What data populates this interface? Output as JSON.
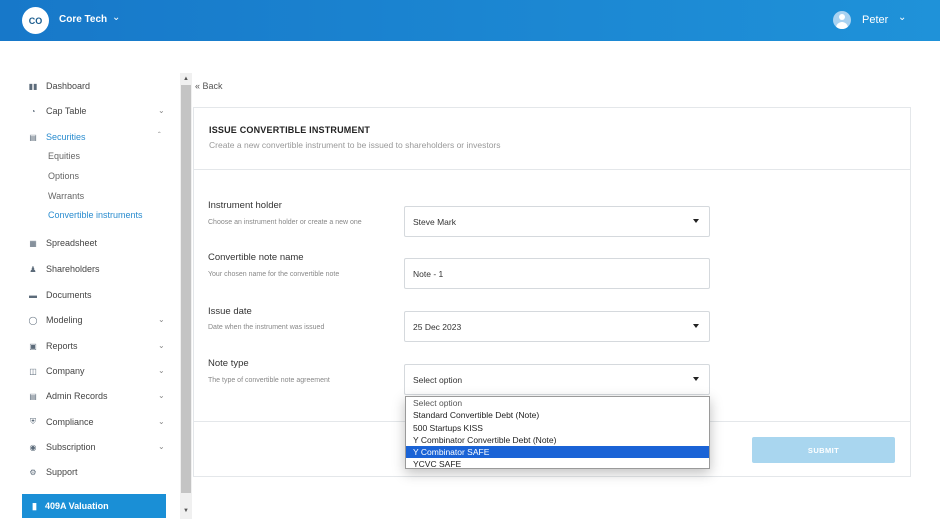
{
  "header": {
    "company_initials": "CO",
    "company_name": "Core Tech",
    "user_name": "Peter"
  },
  "sidebar": {
    "items": [
      {
        "label": "Dashboard",
        "icon": "dashboard-icon"
      },
      {
        "label": "Cap Table",
        "icon": "pie-chart-icon",
        "expandable": true
      },
      {
        "label": "Securities",
        "icon": "clipboard-icon",
        "expandable": true,
        "expanded": true,
        "active": true
      },
      {
        "label": "Spreadsheet",
        "icon": "spreadsheet-icon"
      },
      {
        "label": "Shareholders",
        "icon": "person-icon"
      },
      {
        "label": "Documents",
        "icon": "folder-icon"
      },
      {
        "label": "Modeling",
        "icon": "lightbulb-icon",
        "expandable": true
      },
      {
        "label": "Reports",
        "icon": "report-icon",
        "expandable": true
      },
      {
        "label": "Company",
        "icon": "building-icon",
        "expandable": true
      },
      {
        "label": "Admin Records",
        "icon": "records-icon",
        "expandable": true
      },
      {
        "label": "Compliance",
        "icon": "shield-icon",
        "expandable": true
      },
      {
        "label": "Subscription",
        "icon": "subscription-icon",
        "expandable": true
      },
      {
        "label": "Support",
        "icon": "support-icon"
      }
    ],
    "securities_sub": [
      {
        "label": "Equities"
      },
      {
        "label": "Options"
      },
      {
        "label": "Warrants"
      },
      {
        "label": "Convertible instruments",
        "active": true
      }
    ],
    "valuation_label": "409A Valuation"
  },
  "back_label": "« Back",
  "form": {
    "title": "ISSUE CONVERTIBLE INSTRUMENT",
    "subtitle": "Create a new convertible instrument to be issued to shareholders or investors",
    "fields": [
      {
        "label": "Instrument holder",
        "help": "Choose an instrument holder or create a new one",
        "value": "Steve Mark",
        "type": "select"
      },
      {
        "label": "Convertible note name",
        "help": "Your chosen name for the convertible note",
        "value": "Note - 1",
        "type": "text"
      },
      {
        "label": "Issue date",
        "help": "Date when the instrument was issued",
        "value": "25 Dec 2023",
        "type": "select"
      },
      {
        "label": "Note type",
        "help": "The type of convertible note agreement",
        "value": "Select option",
        "type": "select"
      }
    ],
    "note_type_options": [
      "Select option",
      "Standard Convertible Debt (Note)",
      "500 Startups KISS",
      "Y Combinator Convertible Debt (Note)",
      "Y Combinator SAFE",
      "YCVC SAFE"
    ],
    "note_type_highlighted": "Y Combinator SAFE",
    "submit_label": "SUBMIT"
  },
  "colors": {
    "header_start": "#1778c9",
    "header_end": "#1f92d9",
    "accent": "#2a8ccf",
    "submit_disabled": "#a9d6ef",
    "option_highlight": "#1a63d6"
  }
}
